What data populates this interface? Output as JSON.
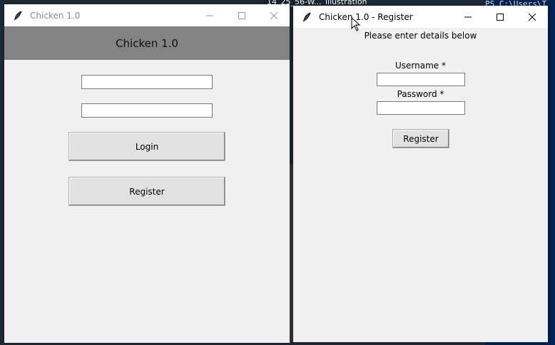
{
  "desktop": {
    "taskbar_text_1": "14_25_56-W...",
    "taskbar_text_2": "illustration",
    "powershell_prompt": "PS C:\\Users\\T"
  },
  "login_window": {
    "title": "Chicken 1.0",
    "header": "Chicken 1.0",
    "username_value": "",
    "password_value": "",
    "login_label": "Login",
    "register_label": "Register"
  },
  "register_window": {
    "title": "Chicken 1.0 - Register",
    "instructions": "Please enter details below",
    "username_label": "Username *",
    "password_label": "Password *",
    "username_value": "",
    "password_value": "",
    "register_label": "Register"
  }
}
